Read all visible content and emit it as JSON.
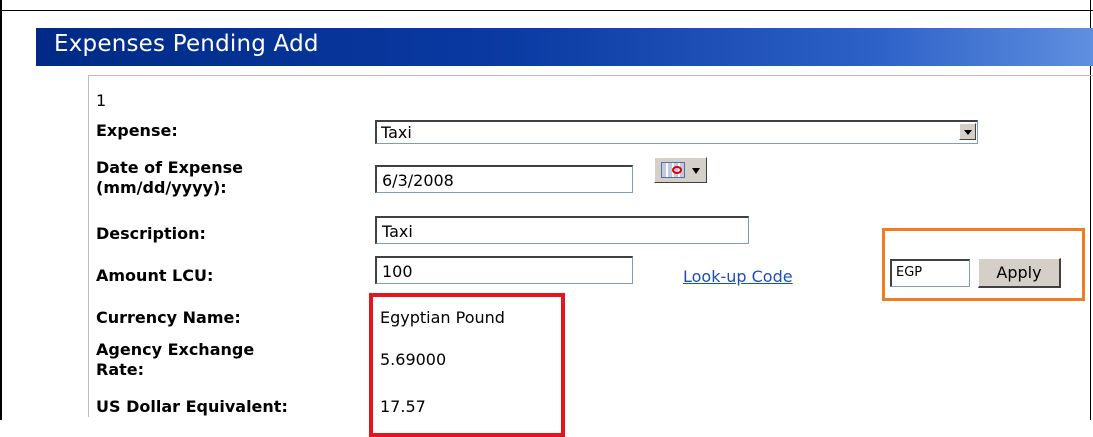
{
  "title": "Expenses Pending Add",
  "record_number": "1",
  "fields": {
    "expense": {
      "label": "Expense:",
      "value": "Taxi"
    },
    "date": {
      "label_line1": "Date of Expense",
      "label_line2": "(mm/dd/yyyy):",
      "value": "6/3/2008"
    },
    "description": {
      "label": "Description:",
      "value": "Taxi"
    },
    "amount": {
      "label": "Amount LCU:",
      "value": "100"
    },
    "currency_name": {
      "label": "Currency Name:",
      "value": "Egyptian Pound"
    },
    "exchange_rate": {
      "label_line1": "Agency Exchange",
      "label_line2": "Rate:",
      "value": "5.69000"
    },
    "usd_equivalent": {
      "label": "US Dollar Equivalent:",
      "value": "17.57"
    }
  },
  "lookup": {
    "link_label": "Look-up Code",
    "code_value": "EGP",
    "apply_label": "Apply"
  },
  "highlight_colors": {
    "orange_box": "#f07d1e",
    "red_box": "#e5141e",
    "title_bar": "#0a3aa3"
  },
  "icons": {
    "calendar": "calendar-icon",
    "dropdown": "chevron-down-icon"
  }
}
